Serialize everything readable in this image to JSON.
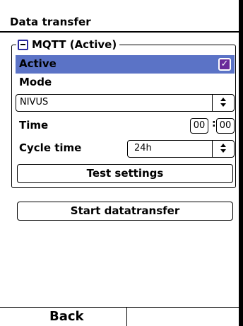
{
  "header": {
    "title": "Data transfer"
  },
  "mqtt": {
    "group_title": "MQTT (Active)",
    "active_label": "Active",
    "active_checked": true,
    "mode_label": "Mode",
    "mode_value": "NIVUS",
    "time_label": "Time",
    "time_hours": "00",
    "time_separator": ":",
    "time_minutes": "00",
    "cycle_label": "Cycle time",
    "cycle_value": "24h",
    "test_button": "Test settings"
  },
  "actions": {
    "start_button": "Start datatransfer"
  },
  "softkeys": {
    "left": "Back",
    "right": ""
  },
  "colors": {
    "highlight": "#5b73c6",
    "checkbox": "#6a2a9a"
  },
  "icons": {
    "collapse": "minus-square-icon",
    "spinner": "up-down-spinner-icon",
    "check": "checkmark-icon"
  }
}
